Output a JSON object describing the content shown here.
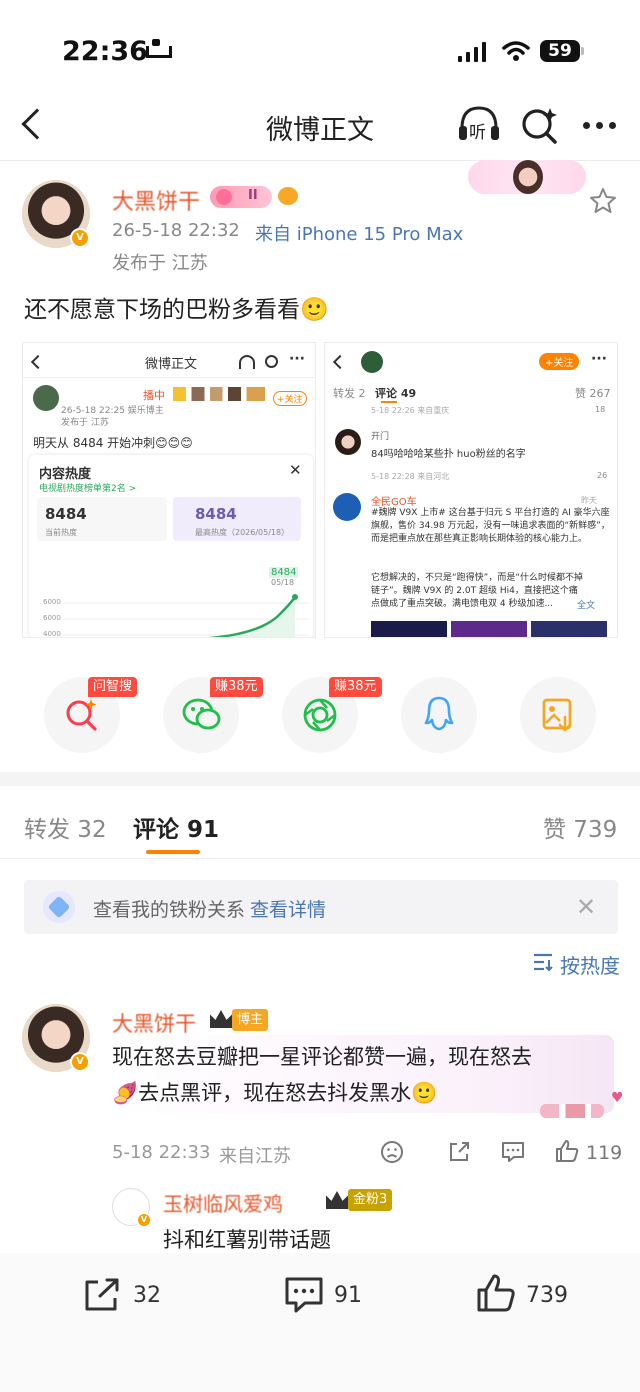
{
  "status_bar": {
    "time": "22:36",
    "battery": "59"
  },
  "nav": {
    "title": "微博正文",
    "listen_label": "听"
  },
  "post": {
    "author": "大黑饼干",
    "level_badge": "II",
    "time": "26-5-18 22:32",
    "source": "来自 iPhone 15 Pro Max",
    "location": "发布于 江苏",
    "text": "还不愿意下场的巴粉多看看🙂"
  },
  "image_left": {
    "title": "微博正文",
    "author_suffix": "播中",
    "meta": "26-5-18 22:25  娱乐博主",
    "location": "发布于 江苏",
    "follow": "+关注",
    "text": "明天从 8484 开始冲刺😊😊😊",
    "panel_title": "内容热度",
    "panel_sub": "电视剧热度榜单第2名 >",
    "current_value": "8484",
    "current_label": "当前热度",
    "peak_value": "8484",
    "peak_label": "最高热度（2026/05/18）",
    "chart_tag_value": "8484",
    "chart_tag_date": "05/18",
    "y_ticks": [
      "6000",
      "6000",
      "4000"
    ]
  },
  "image_right": {
    "follow": "+关注",
    "tab_repost": "转发 2",
    "tab_comment": "评论 49",
    "likes": "赞 267",
    "row1_meta": "5-18 22:26 来自重庆",
    "row1_likes": "18",
    "user_prefix": "开门",
    "comment1": "84吗哈哈哈某些扑 huo粉丝的名字",
    "row2_meta": "5-18 22:28 来自河北",
    "row2_likes": "26",
    "card_name": "全民GO车",
    "card_time": "昨天",
    "card_text1": "#魏牌 V9X 上市# 这台基于归元 S 平台打造的 AI 豪华六座旗舰，售价 34.98 万元起，没有一味追求表面的“新鲜感”，而是把重点放在那些真正影响长期体验的核心能力上。",
    "card_text2": "它想解决的，不只是“跑得快”，而是“什么时候都不掉链子”。魏牌 V9X 的 2.0T 超级 Hi4，直接把这个痛点做成了重点突破。满电馈电双 4 秒级加速...",
    "card_more": "全文"
  },
  "share": {
    "items": [
      {
        "name": "ai-search",
        "tag": "问智搜"
      },
      {
        "name": "wechat",
        "tag": "赚38元"
      },
      {
        "name": "moments",
        "tag": "赚38元"
      },
      {
        "name": "qq",
        "tag": ""
      },
      {
        "name": "save-image",
        "tag": ""
      }
    ]
  },
  "tabs": {
    "repost": "转发 32",
    "comment": "评论 91",
    "like": "赞 739"
  },
  "fan_banner": {
    "text": "查看我的铁粉关系",
    "link": "查看详情"
  },
  "sort_label": "按热度",
  "comment": {
    "author": "大黑饼干",
    "badge": "博主",
    "line1": "现在怒去豆瓣把一星评论都赞一遍，现在怒去",
    "line2": "🍠去点黑评，现在怒去抖发黑水🙂",
    "time": "5-18 22:33",
    "location": "来自江苏",
    "likes": "119"
  },
  "reply": {
    "author": "玉树临风爱鸡",
    "badge": "金粉3",
    "text": "抖和红薯别带话题"
  },
  "bottom": {
    "repost": "32",
    "comment": "91",
    "like": "739"
  },
  "colors": {
    "accent": "#ff8200",
    "name": "#e9552b",
    "link": "#4a77b4",
    "tag_red": "#ff4a3d"
  }
}
